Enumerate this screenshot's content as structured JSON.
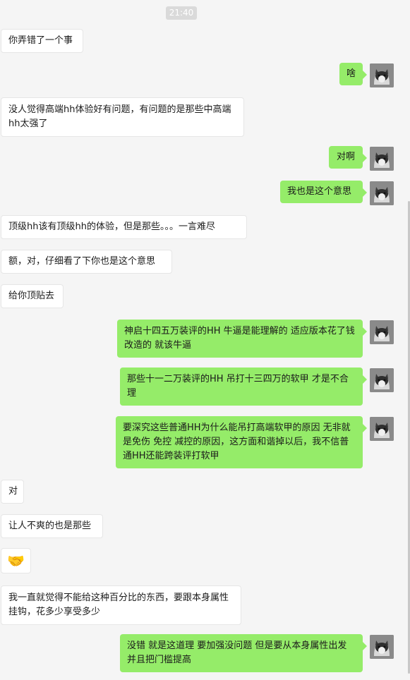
{
  "timestamp": "21:40",
  "messages": [
    {
      "dir": "in",
      "text": "你弄错了一个事"
    },
    {
      "dir": "out",
      "text": "啥"
    },
    {
      "dir": "in",
      "text": "没人觉得高端hh体验好有问题，有问题的是那些中高端hh太强了"
    },
    {
      "dir": "out",
      "text": "对啊"
    },
    {
      "dir": "out",
      "text": "我也是这个意思"
    },
    {
      "dir": "in",
      "text": "顶级hh该有顶级hh的体验，但是那些。。。一言难尽"
    },
    {
      "dir": "in",
      "text": "额，对，仔细看了下你也是这个意思"
    },
    {
      "dir": "in",
      "text": "给你顶贴去"
    },
    {
      "dir": "out",
      "text": "神启十四五万装评的HH 牛逼是能理解的  适应版本花了钱改造的  就该牛逼"
    },
    {
      "dir": "out",
      "text": "那些十一二万装评的HH 吊打十三四万的软甲 才是不合理"
    },
    {
      "dir": "out",
      "text": "要深究这些普通HH为什么能吊打高端软甲的原因 无非就是免伤 免控 减控的原因，这方面和谐掉以后，我不信普通HH还能跨装评打软甲"
    },
    {
      "dir": "in",
      "text": "对"
    },
    {
      "dir": "in",
      "text": "让人不爽的也是那些"
    },
    {
      "dir": "in",
      "text": "🤝",
      "icon": "handshake-icon"
    },
    {
      "dir": "in",
      "text": "我一直就觉得不能给这种百分比的东西，要跟本身属性挂钩，花多少享受多少"
    },
    {
      "dir": "out",
      "text": "没错  就是这道理 要加强没问题 但是要从本身属性出发并且把门槛提高"
    }
  ]
}
